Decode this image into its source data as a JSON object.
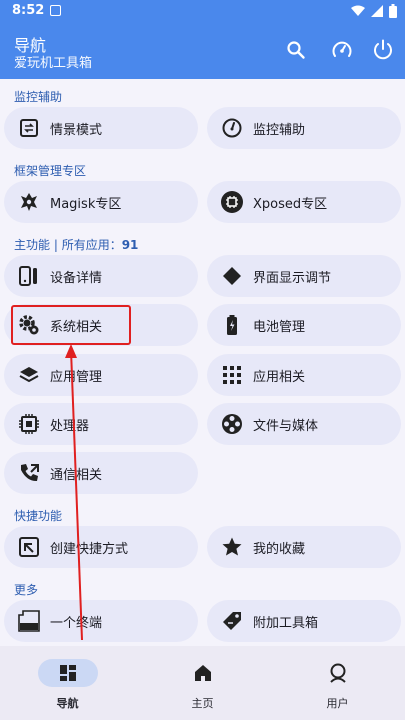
{
  "status": {
    "time": "8:52"
  },
  "header": {
    "title": "导航",
    "subtitle": "爱玩机工具箱"
  },
  "sections": {
    "monitor": {
      "title": "监控辅助"
    },
    "framework": {
      "title": "框架管理专区"
    },
    "main": {
      "title": "主功能",
      "apps_label": "所有应用：",
      "apps_count": "91"
    },
    "shortcut": {
      "title": "快捷功能"
    },
    "more": {
      "title": "更多"
    }
  },
  "cards": {
    "scene_mode": "情景模式",
    "monitor_assist": "监控辅助",
    "magisk": "Magisk专区",
    "xposed": "Xposed专区",
    "device_info": "设备详情",
    "display_adjust": "界面显示调节",
    "system": "系统相关",
    "battery": "电池管理",
    "app_manage": "应用管理",
    "app_related": "应用相关",
    "processor": "处理器",
    "files_media": "文件与媒体",
    "comm": "通信相关",
    "create_shortcut": "创建快捷方式",
    "favorites": "我的收藏",
    "terminal": "一个终端",
    "extra_tools": "附加工具箱"
  },
  "nav": {
    "nav_label": "导航",
    "home_label": "主页",
    "user_label": "用户"
  },
  "icons": {
    "search": "search-icon",
    "speed": "speedometer-icon",
    "power": "power-icon",
    "shell": "shell-icon",
    "tag": "tag-icon"
  },
  "colors": {
    "accent": "#4a88ec",
    "card": "#e7e8f8",
    "section_text": "#2d5db0",
    "highlight": "#e02020"
  }
}
